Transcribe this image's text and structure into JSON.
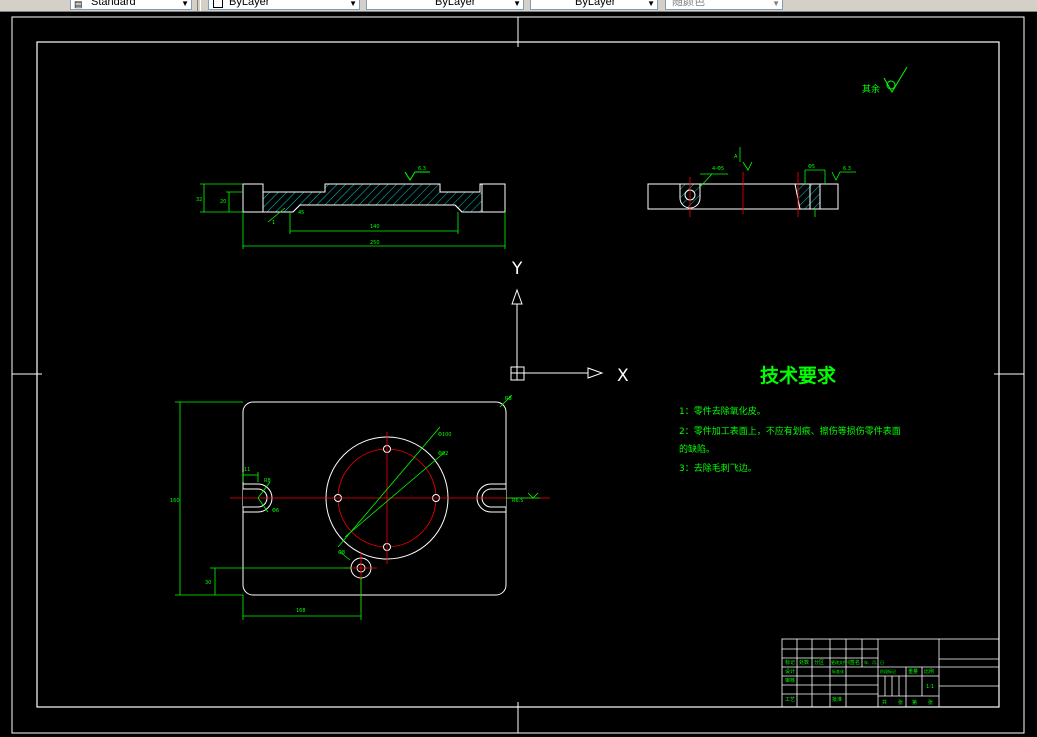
{
  "toolbar": {
    "textstyle": "Standard",
    "layer": "ByLayer",
    "linetype": "ByLayer",
    "lineweight": "ByLayer",
    "plotstyle": "随颜色"
  },
  "ucs": {
    "x_label": "X",
    "y_label": "Y"
  },
  "roughness": {
    "text": "其余",
    "value_top": "6.3",
    "value_side": "6.3"
  },
  "side_view": {
    "dim_overall": "250",
    "dim_inner": "140",
    "dim_height_a": "32",
    "dim_height_b": "20",
    "dim_small": "1",
    "dim_angle": "45"
  },
  "section_view": {
    "dim_a": "4-Φ5",
    "dim_b": "Φ5",
    "label_a": "A",
    "label_b": "A-A"
  },
  "plan_view": {
    "dim_height": "160",
    "dim_width": "168",
    "dim_bottom": "30",
    "dim_slot": "11",
    "dim_circle_outer": "Φ100",
    "dim_circle_bolt": "Φ82",
    "dim_r_a": "R8",
    "dim_r_b": "R6.5",
    "dim_hole": "Φ6",
    "dim_corner": "R8",
    "dim_small_hole": "Φ8"
  },
  "tech_req": {
    "title": "技术要求",
    "items": [
      "1：零件去除氧化皮。",
      "2：零件加工表面上，不应有划痕、擦伤等损伤零件表面",
      "的缺陷。",
      "3：去除毛刺飞边。"
    ]
  },
  "title_block": {
    "row_mark": [
      "标记",
      "处数",
      "分区",
      "更改文件号",
      "签名",
      "年、月、日"
    ],
    "design": "设计",
    "standard": "标准化",
    "review": "审核",
    "process": "工艺",
    "approve": "批准",
    "stage": "阶段标记",
    "weight": "重量",
    "scale": "比例",
    "scale_val": "1:1",
    "sheets": [
      "共",
      "张",
      "第",
      "张"
    ]
  },
  "colors": {
    "outline": "#ffffff",
    "dimension": "#00ff00",
    "centerline": "#ff0000",
    "hatch": "#00ffff",
    "tech_text": "#00ff00"
  }
}
